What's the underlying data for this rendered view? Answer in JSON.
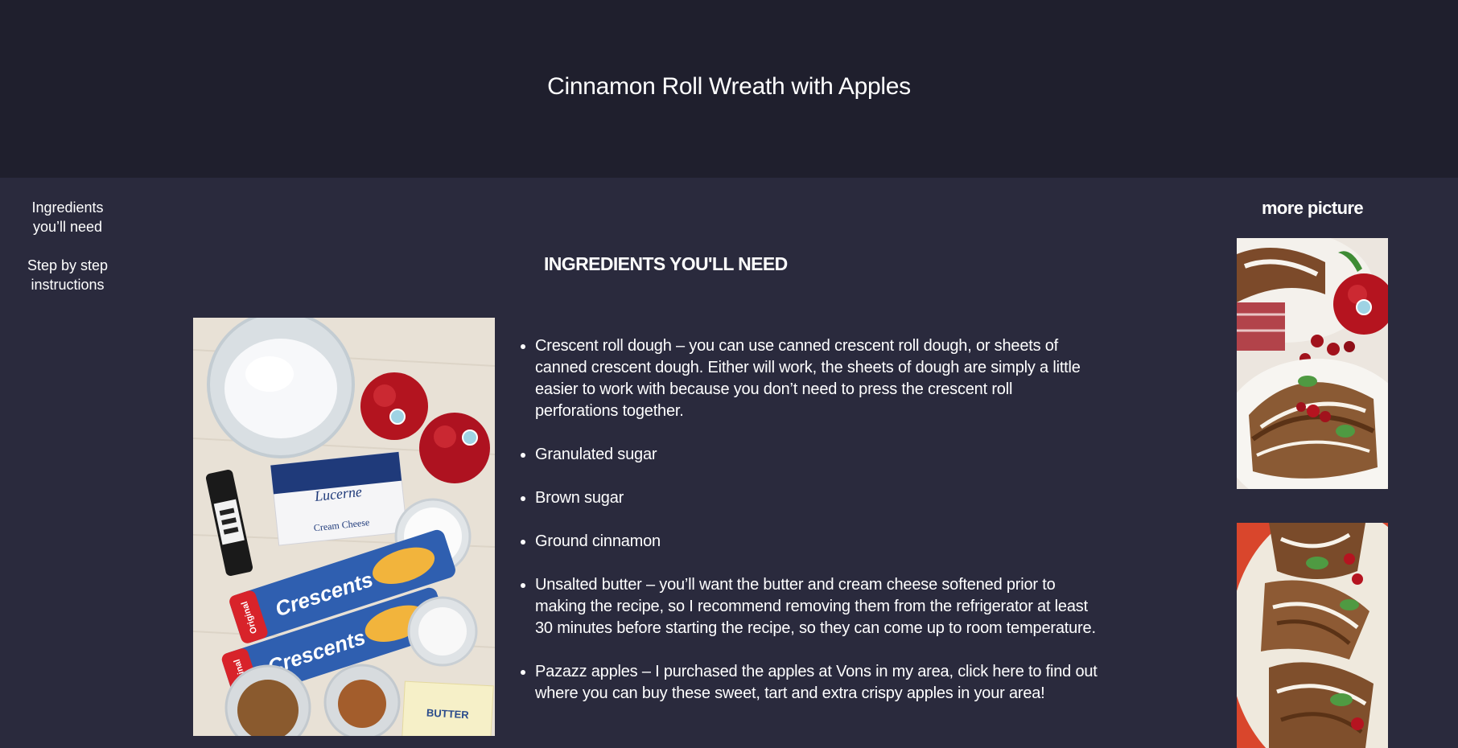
{
  "header": {
    "title": "Cinnamon Roll Wreath with Apples"
  },
  "sidebar": {
    "items": [
      {
        "label": "Ingredients you’ll need"
      },
      {
        "label": "Step by step instructions"
      }
    ]
  },
  "section": {
    "heading": "INGREDIENTS YOU'LL NEED",
    "photo_labels": {
      "cream_cheese_brand": "Lucerne",
      "cream_cheese": "Cream Cheese",
      "crescents_1": "Crescents",
      "crescents_2": "Crescents",
      "original_1": "Original",
      "original_2": "Original",
      "butter": "BUTTER"
    },
    "ingredients": [
      "Crescent roll dough – you can use canned crescent roll dough, or sheets of canned crescent dough. Either will work, the sheets of dough are simply a little easier to work with because you don’t need to press the crescent roll perforations together.",
      "Granulated sugar",
      "Brown sugar",
      "Ground cinnamon",
      "Unsalted butter – you’ll want the butter and cream cheese softened prior to making the recipe, so I recommend removing them from the refrigerator at least 30 minutes before starting the recipe, so they can come up to room temperature.",
      "Pazazz apples – I purchased the apples at Vons in my area, click here to find out where you can buy these sweet, tart and extra crispy apples in your area!"
    ]
  },
  "more": {
    "title": "more picture"
  },
  "colors": {
    "header_bg": "#1f1f2d",
    "page_bg": "#2a2a3d",
    "text": "#ffffff"
  }
}
